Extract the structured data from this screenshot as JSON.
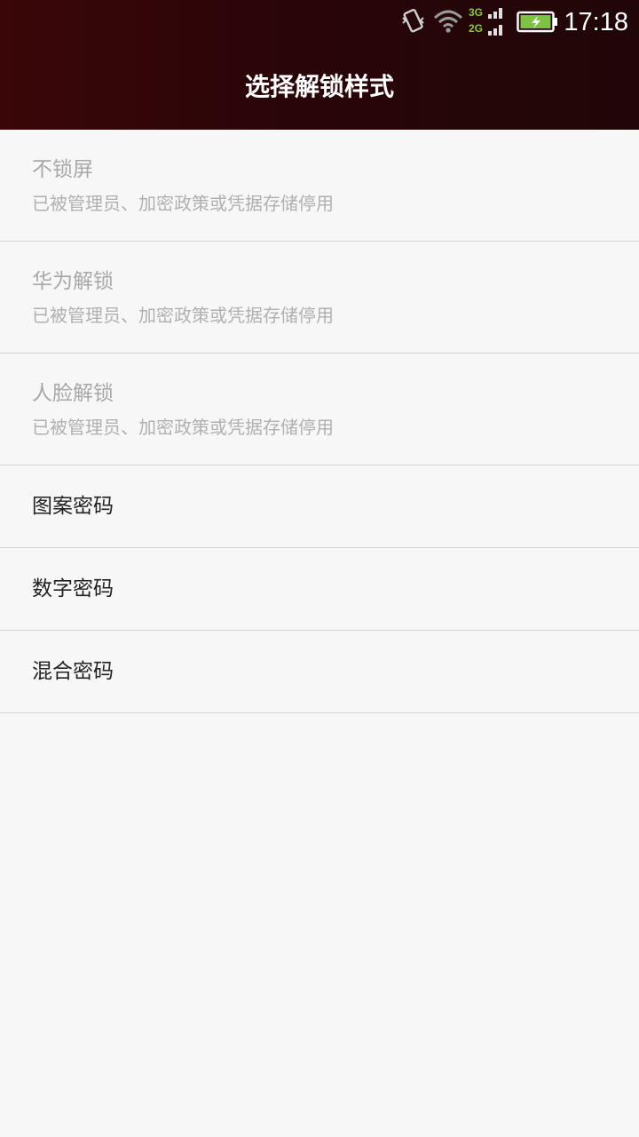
{
  "status_bar": {
    "time": "17:18",
    "network_3g": "3G",
    "network_2g": "2G",
    "icons": [
      "vibrate-icon",
      "wifi-icon",
      "signal-icon",
      "battery-charging-icon"
    ]
  },
  "header": {
    "title": "选择解锁样式"
  },
  "list": {
    "items": [
      {
        "label": "不锁屏",
        "sublabel": "已被管理员、加密政策或凭据存储停用",
        "enabled": false
      },
      {
        "label": "华为解锁",
        "sublabel": "已被管理员、加密政策或凭据存储停用",
        "enabled": false
      },
      {
        "label": "人脸解锁",
        "sublabel": "已被管理员、加密政策或凭据存储停用",
        "enabled": false
      },
      {
        "label": "图案密码",
        "enabled": true
      },
      {
        "label": "数字密码",
        "enabled": true
      },
      {
        "label": "混合密码",
        "enabled": true
      }
    ]
  },
  "colors": {
    "header_bg": "#2a0508",
    "page_bg": "#f7f7f7",
    "disabled_text": "#a8a8a8",
    "enabled_text": "#222222",
    "divider": "#d6d6d6",
    "network_green": "#8cc63f",
    "battery_green": "#7dc242"
  }
}
